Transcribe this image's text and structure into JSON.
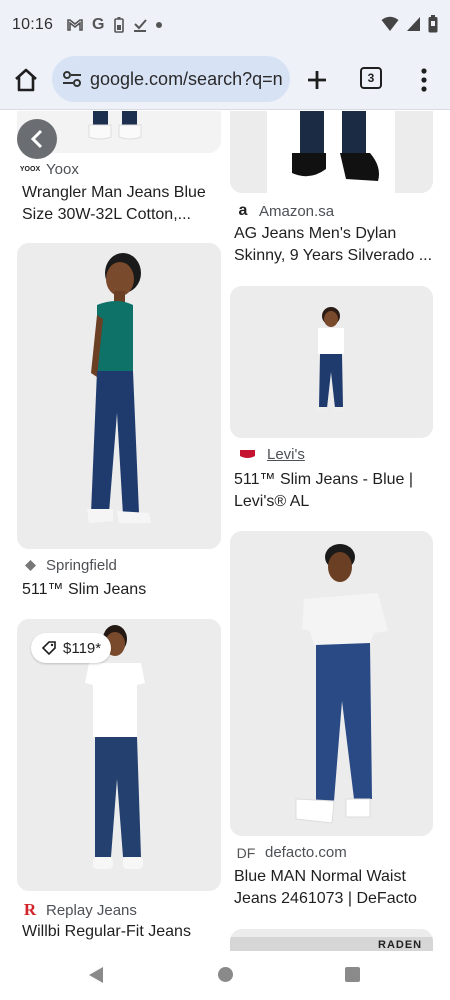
{
  "status": {
    "time": "10:16"
  },
  "toolbar": {
    "url": "google.com/search?q=n",
    "tab_count": "3"
  },
  "results": [
    {
      "source": "Yoox",
      "title": "Wrangler Man Jeans Blue Size 30W-32L Cotton,..."
    },
    {
      "source": "Amazon.sa",
      "title": "AG Jeans Men's Dylan Skinny, 9 Years Silverado ..."
    },
    {
      "source": "Springfield",
      "title": "511™ Slim Jeans"
    },
    {
      "source": "Levi's",
      "title": "511™ Slim Jeans - Blue | Levi's® AL"
    },
    {
      "source": "Replay Jeans",
      "title": "Willbi Regular-Fit Jeans",
      "price": "$119*"
    },
    {
      "source": "defacto.com",
      "title": "Blue MAN Normal Waist Jeans 2461073 | DeFacto"
    }
  ],
  "favicons": {
    "yoox": "YOOX",
    "amazon": "a",
    "df": "DF",
    "replay": "R"
  },
  "partial_text": "RADEN",
  "colors": {
    "chrome_bg": "#eef1f8",
    "omnibox": "#d7e3f5",
    "denim": "#1f3b6e",
    "teal_shirt": "#0f7268",
    "levis_red": "#c41230",
    "replay_red": "#d2232a"
  }
}
